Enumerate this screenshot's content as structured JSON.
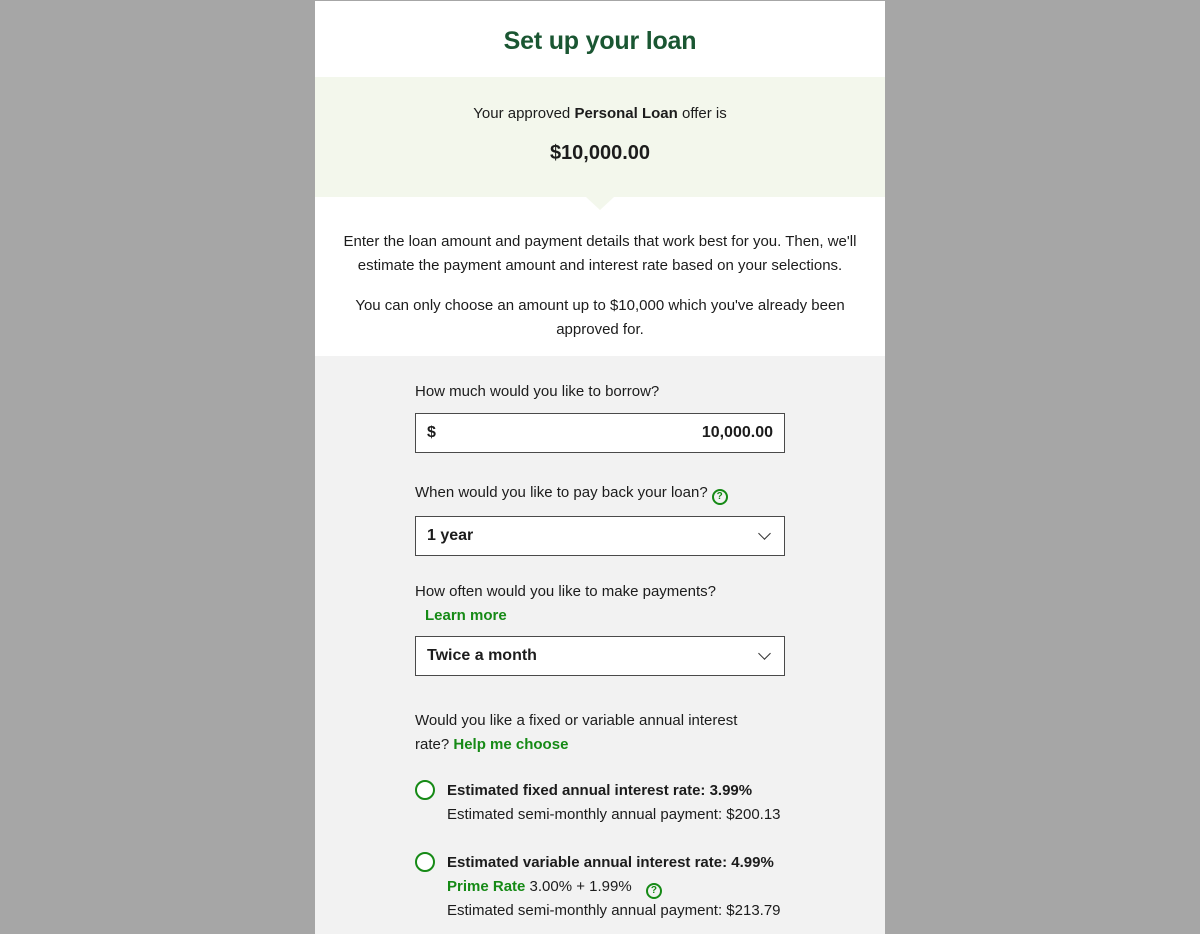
{
  "header": {
    "title": "Set up your loan"
  },
  "offer": {
    "prefix": "Your approved",
    "product": "Personal Loan",
    "suffix": "offer is",
    "amount": "$10,000.00"
  },
  "intro": {
    "paragraph1": "Enter the loan amount and payment details that work best for you. Then, we'll estimate the payment amount and interest rate based on your selections.",
    "paragraph2": "You can only choose an amount up to $10,000 which you've already been approved for."
  },
  "form": {
    "borrow": {
      "label": "How much would you like to borrow?",
      "currency": "$",
      "value": "10,000.00"
    },
    "term": {
      "label": "When would you like to pay back your loan?",
      "help_icon": "question-circle-icon",
      "selected": "1 year"
    },
    "frequency": {
      "label": "How often would you like to make payments?",
      "learn_more": "Learn more",
      "selected": "Twice a month"
    },
    "rate_type": {
      "label": "Would you like a fixed or variable annual interest rate?",
      "help_link": "Help me choose"
    },
    "options": [
      {
        "title": "Estimated fixed annual interest rate: 3.99%",
        "payment": "Estimated semi-monthly annual payment: $200.13",
        "selected": false
      },
      {
        "title": "Estimated variable annual interest rate: 4.99%",
        "prime_label": "Prime Rate",
        "prime_value": "3.00% + 1.99%",
        "payment": "Estimated semi-monthly annual payment: $213.79",
        "selected": false
      }
    ]
  },
  "colors": {
    "brand_green": "#1a5632",
    "link_green": "#168a16",
    "offer_bg": "#f3f7ec",
    "form_bg": "#f2f2f2",
    "backdrop": "#a6a6a6"
  }
}
